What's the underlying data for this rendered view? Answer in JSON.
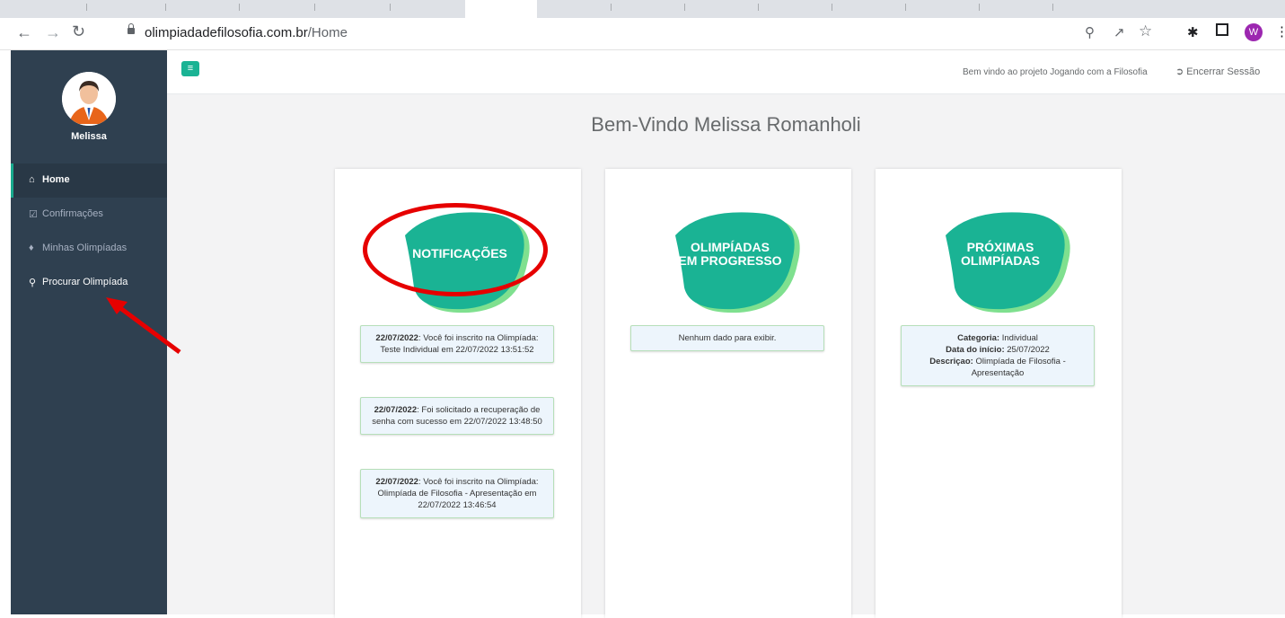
{
  "browser": {
    "url_domain": "olimpiadadefilosofia.com.br",
    "url_path": "/Home",
    "profile_initial": "W",
    "icons": [
      "back-icon",
      "forward-icon",
      "reload-icon",
      "lock-icon",
      "zoom-icon",
      "share-icon",
      "star-icon",
      "extensions-icon",
      "side-panel-icon"
    ]
  },
  "sidebar": {
    "user_name": "Melissa",
    "items": [
      {
        "label": "Home",
        "icon": "home-icon",
        "active": true
      },
      {
        "label": "Confirmações",
        "icon": "check-square-icon",
        "active": false
      },
      {
        "label": "Minhas Olimpíadas",
        "icon": "diamond-icon",
        "active": false
      },
      {
        "label": "Procurar Olimpíada",
        "icon": "search-icon",
        "active": false
      }
    ]
  },
  "header": {
    "welcome_text": "Bem vindo ao projeto Jogando com a Filosofia",
    "logout_label": "Encerrar Sessão"
  },
  "page": {
    "title": "Bem-Vindo Melissa Romanholi"
  },
  "cards": [
    {
      "title_line1": "NOTIFICAÇÕES",
      "title_line2": "",
      "notes": [
        {
          "date": "22/07/2022",
          "text": ": Você foi inscrito na Olimpíada: Teste Individual em 22/07/2022 13:51:52"
        },
        {
          "date": "22/07/2022",
          "text": ": Foi solicitado a recuperação de senha com sucesso em 22/07/2022 13:48:50"
        },
        {
          "date": "22/07/2022",
          "text": ": Você foi inscrito na Olimpíada: Olimpíada de Filosofia - Apresentação em 22/07/2022 13:46:54"
        }
      ]
    },
    {
      "title_line1": "OLIMPÍADAS",
      "title_line2": "EM PROGRESSO",
      "empty_text": "Nenhum dado para exibir."
    },
    {
      "title_line1": "PRÓXIMAS",
      "title_line2": "OLIMPÍADAS",
      "details": {
        "categoria_label": "Categoria:",
        "categoria_value": " Individual",
        "inicio_label": "Data do início:",
        "inicio_value": " 25/07/2022",
        "descricao_label": "Descriçao:",
        "descricao_value": " Olimpíada de Filosofia - Apresentação"
      }
    }
  ],
  "colors": {
    "sidebar_bg": "#2f4050",
    "accent": "#1ab394",
    "blob_shadow": "#7fe08f",
    "annotation": "#e60000"
  }
}
